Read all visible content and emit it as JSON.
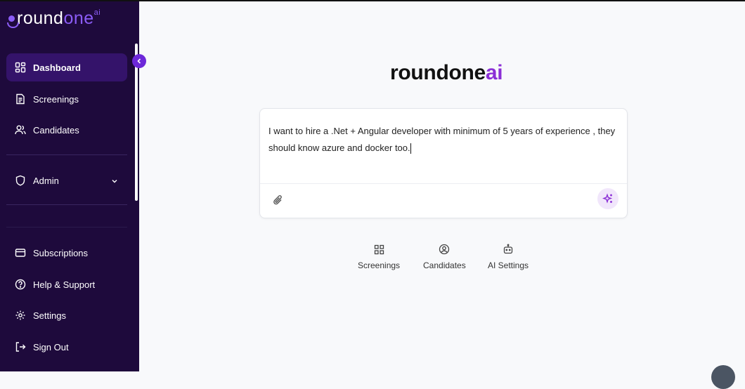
{
  "brand": {
    "sidebar_logo_main": "round",
    "sidebar_logo_accent": "one",
    "sidebar_logo_sup": "ai",
    "main_logo_main": "roundone",
    "main_logo_accent": "ai",
    "accent_color": "#8b2fd6",
    "sidebar_bg": "#1e0a3c"
  },
  "sidebar": {
    "items": [
      {
        "label": "Dashboard",
        "icon": "dashboard-grid-icon",
        "active": true
      },
      {
        "label": "Screenings",
        "icon": "document-icon"
      },
      {
        "label": "Candidates",
        "icon": "users-icon"
      },
      {
        "label": "Admin",
        "icon": "shield-icon",
        "expandable": true
      },
      {
        "label": "Subscriptions",
        "icon": "credit-card-icon"
      },
      {
        "label": "Help & Support",
        "icon": "question-circle-icon"
      },
      {
        "label": "Settings",
        "icon": "gear-icon"
      },
      {
        "label": "Sign Out",
        "icon": "sign-out-icon"
      }
    ]
  },
  "composer": {
    "text": "I want to hire a .Net + Angular developer with minimum of 5 years of experience , they should know azure and docker too."
  },
  "quick_actions": [
    {
      "label": "Screenings",
      "icon": "grid-icon"
    },
    {
      "label": "Candidates",
      "icon": "user-circle-icon"
    },
    {
      "label": "AI Settings",
      "icon": "robot-icon"
    }
  ]
}
